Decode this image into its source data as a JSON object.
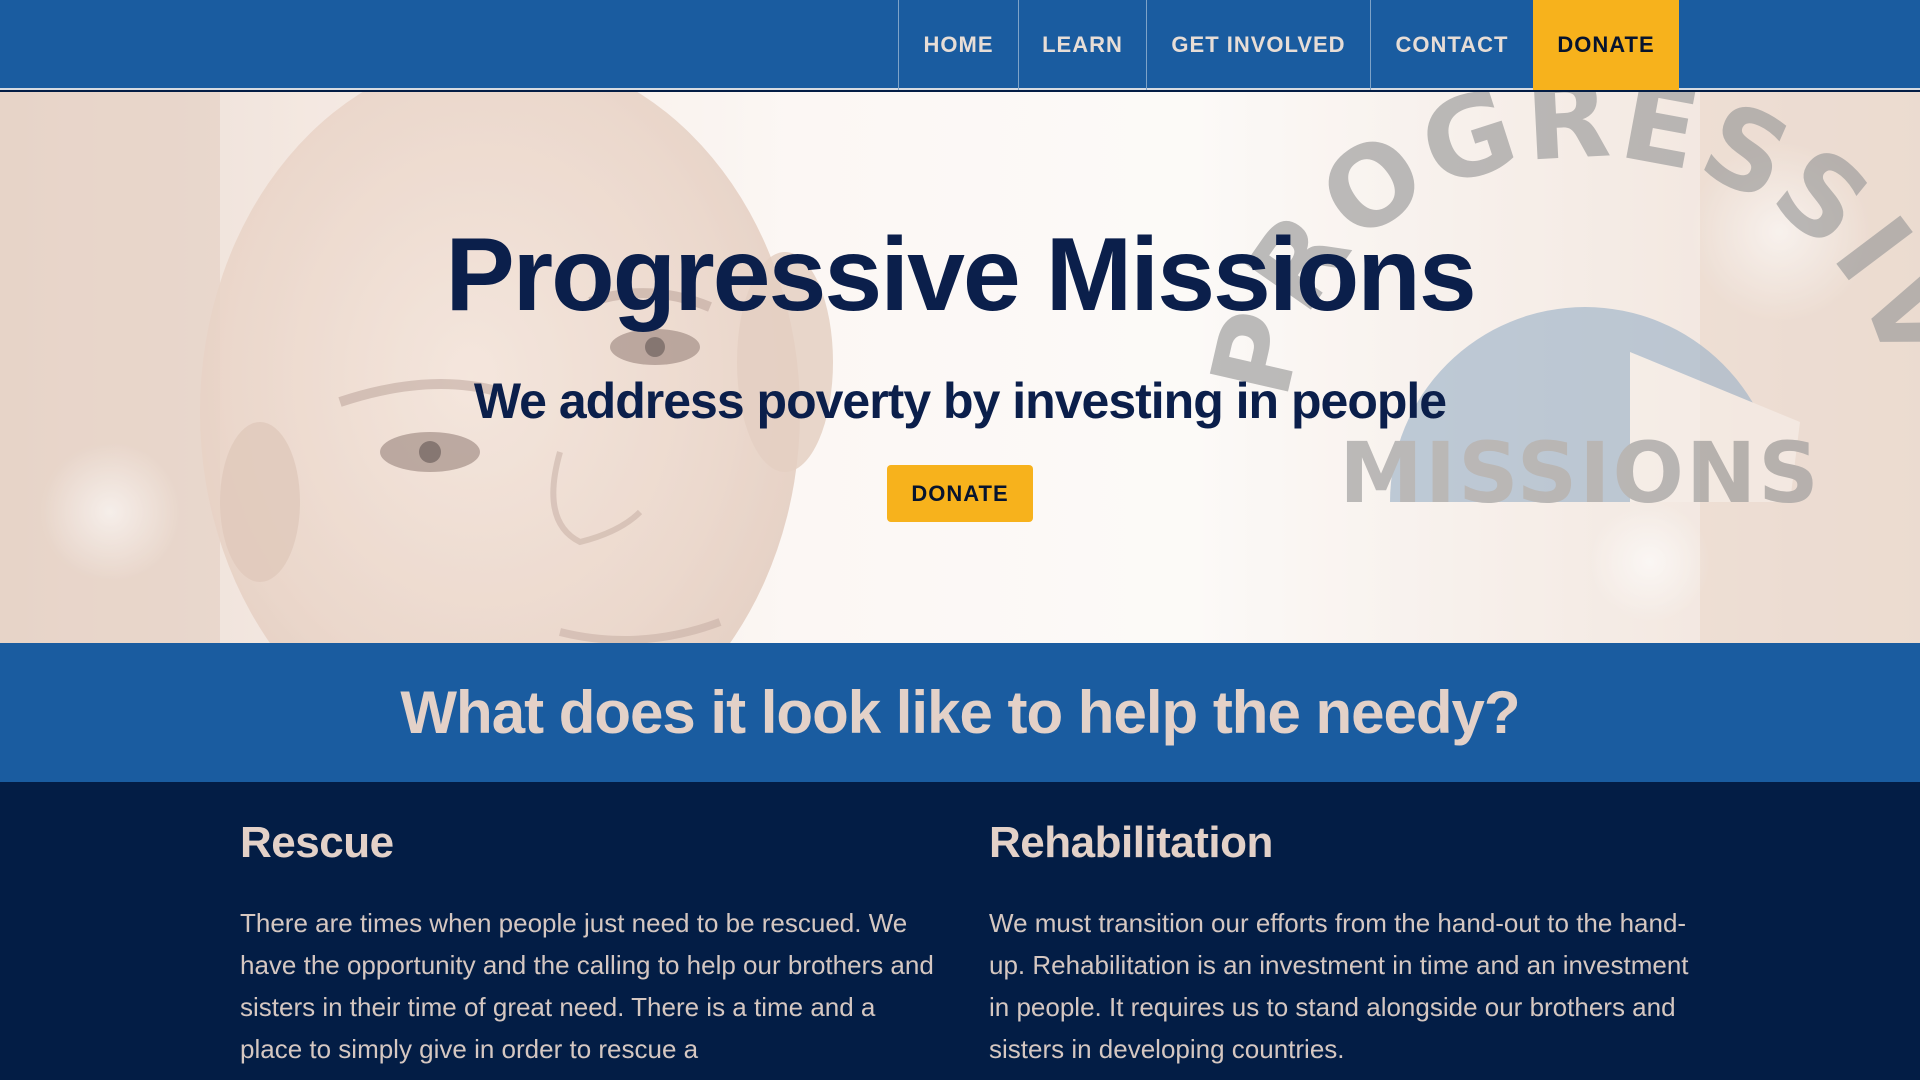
{
  "nav": {
    "items": [
      {
        "label": "HOME"
      },
      {
        "label": "LEARN"
      },
      {
        "label": "GET INVOLVED"
      },
      {
        "label": "CONTACT"
      },
      {
        "label": "DONATE"
      }
    ]
  },
  "hero": {
    "title": "Progressive Missions",
    "subtitle": "We address poverty by investing in people",
    "donate_label": "DONATE",
    "logo": {
      "top_text": "PROGRESSIVE",
      "bottom_text": "MISSIONS"
    }
  },
  "band": {
    "title": "What does it look like to help the needy?"
  },
  "sections": {
    "left": {
      "heading": "Rescue",
      "body": "There are times when people just need to be rescued. We have the opportunity and the calling to help our brothers and sisters in their time of great need. There is a time and a place to simply give in order to rescue a"
    },
    "right": {
      "heading": "Rehabilitation",
      "body": "We must transition our efforts from the hand-out to the hand-up. Rehabilitation is an investment in time and an investment in people. It requires us to stand alongside our brothers and sisters in developing countries."
    }
  },
  "colors": {
    "brand_blue": "#1a5ca0",
    "navy": "#031d45",
    "accent_gold": "#f7b21c",
    "heading_cream": "#e3d1c8"
  }
}
